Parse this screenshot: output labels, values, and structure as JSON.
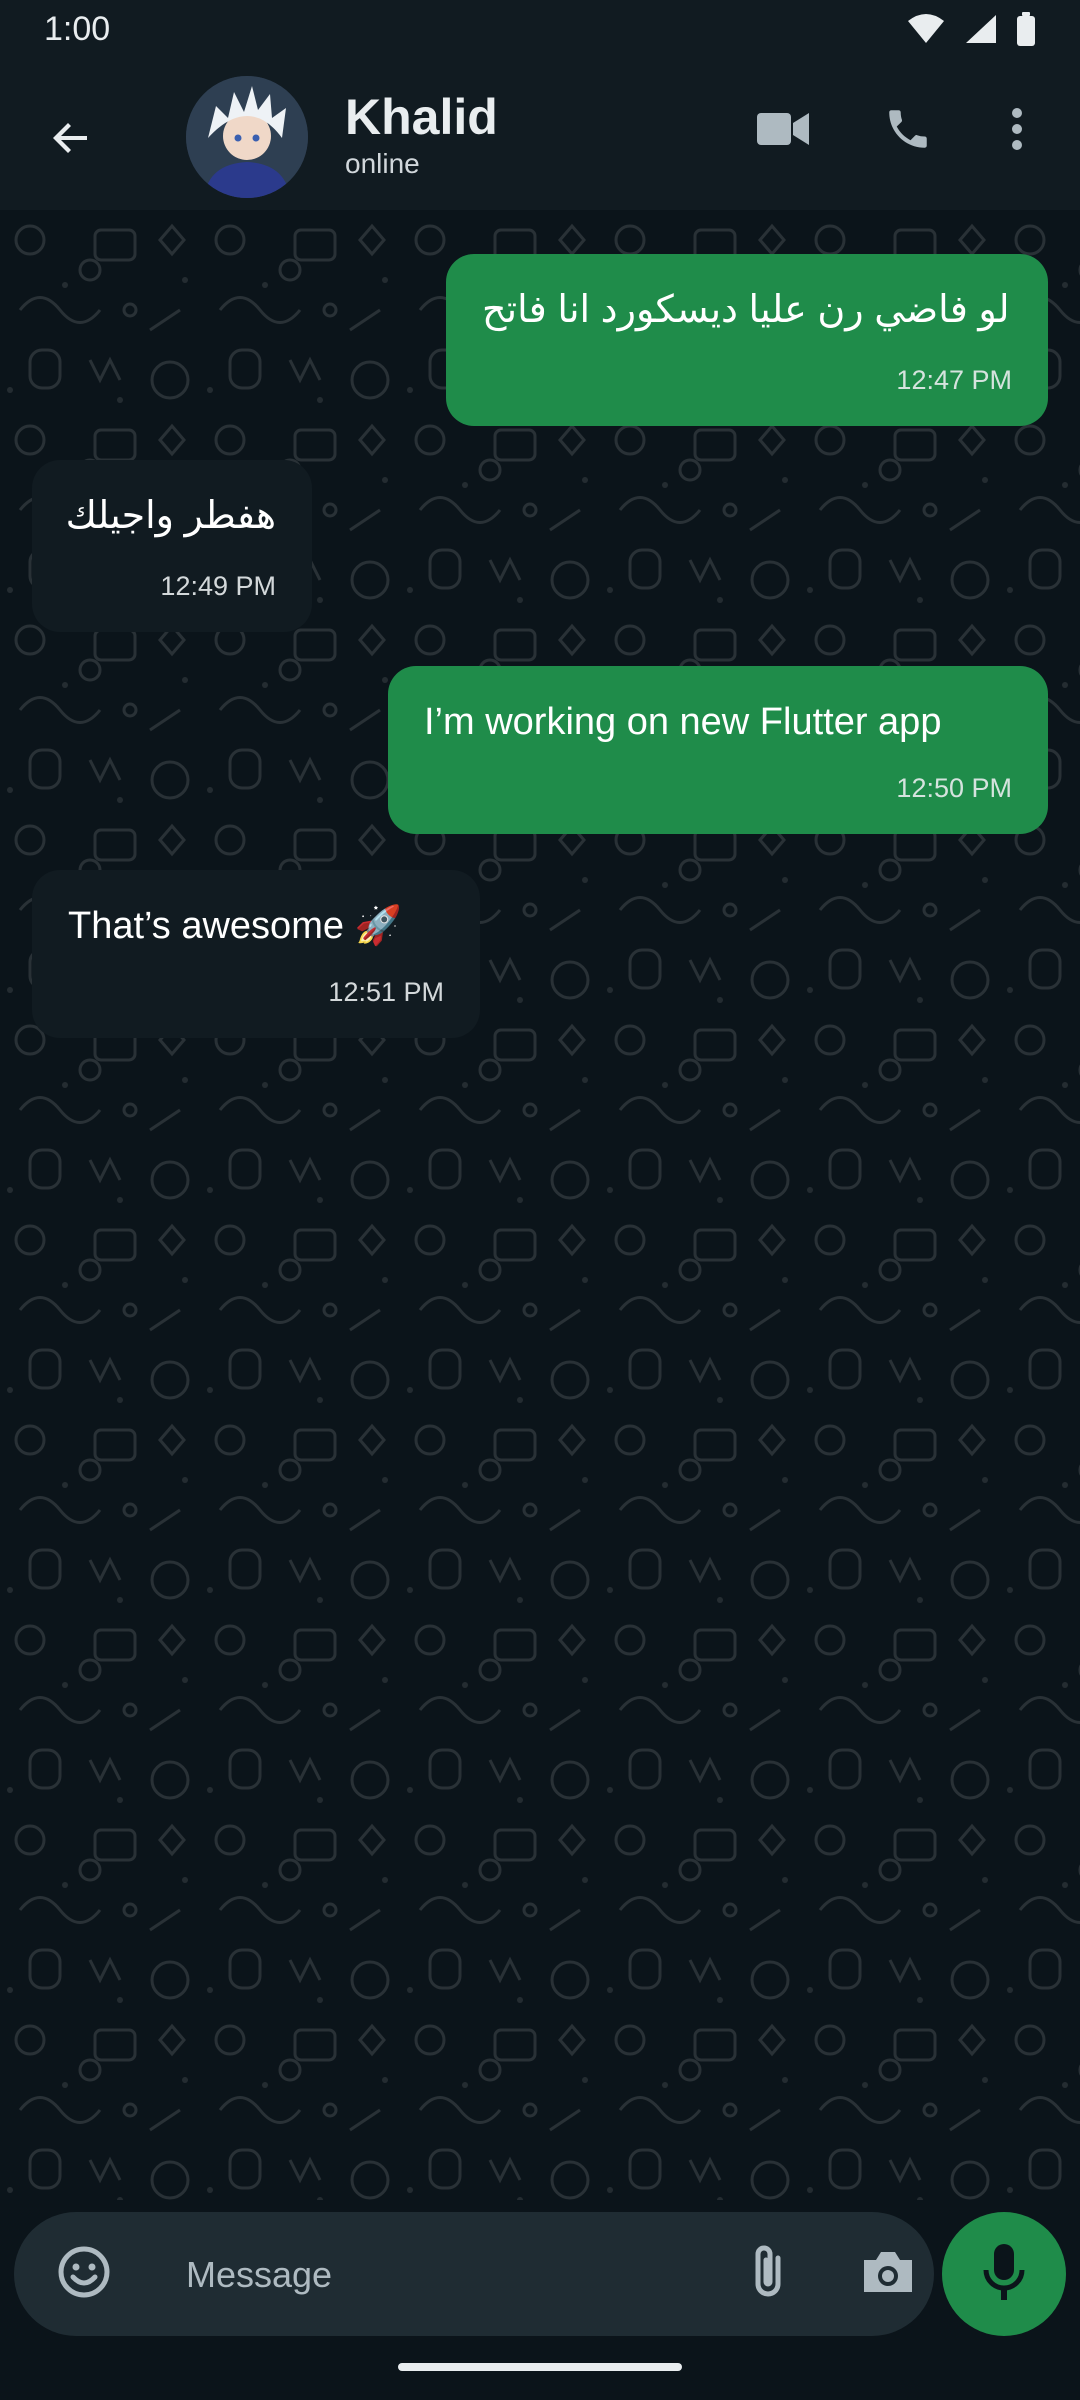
{
  "status_bar": {
    "time": "1:00"
  },
  "app_bar": {
    "contact_name": "Khalid",
    "contact_status": "online"
  },
  "messages": [
    {
      "direction": "outgoing",
      "text": "لو فاضي رن عليا ديسكورد انا فاتح",
      "time": "12:47 PM"
    },
    {
      "direction": "incoming",
      "text": "هفطر واجيلك",
      "time": "12:49 PM"
    },
    {
      "direction": "outgoing",
      "text": "I’m working on new Flutter app",
      "time": "12:50 PM"
    },
    {
      "direction": "incoming",
      "text": "That’s awesome 🚀",
      "time": "12:51 PM"
    }
  ],
  "composer": {
    "placeholder": "Message"
  },
  "colors": {
    "background": "#0b141a",
    "app_bar": "#111b21",
    "outgoing_bubble": "#1f8c4a",
    "incoming_bubble": "#111b21",
    "composer": "#1f2c33",
    "accent": "#1f8c4a"
  }
}
